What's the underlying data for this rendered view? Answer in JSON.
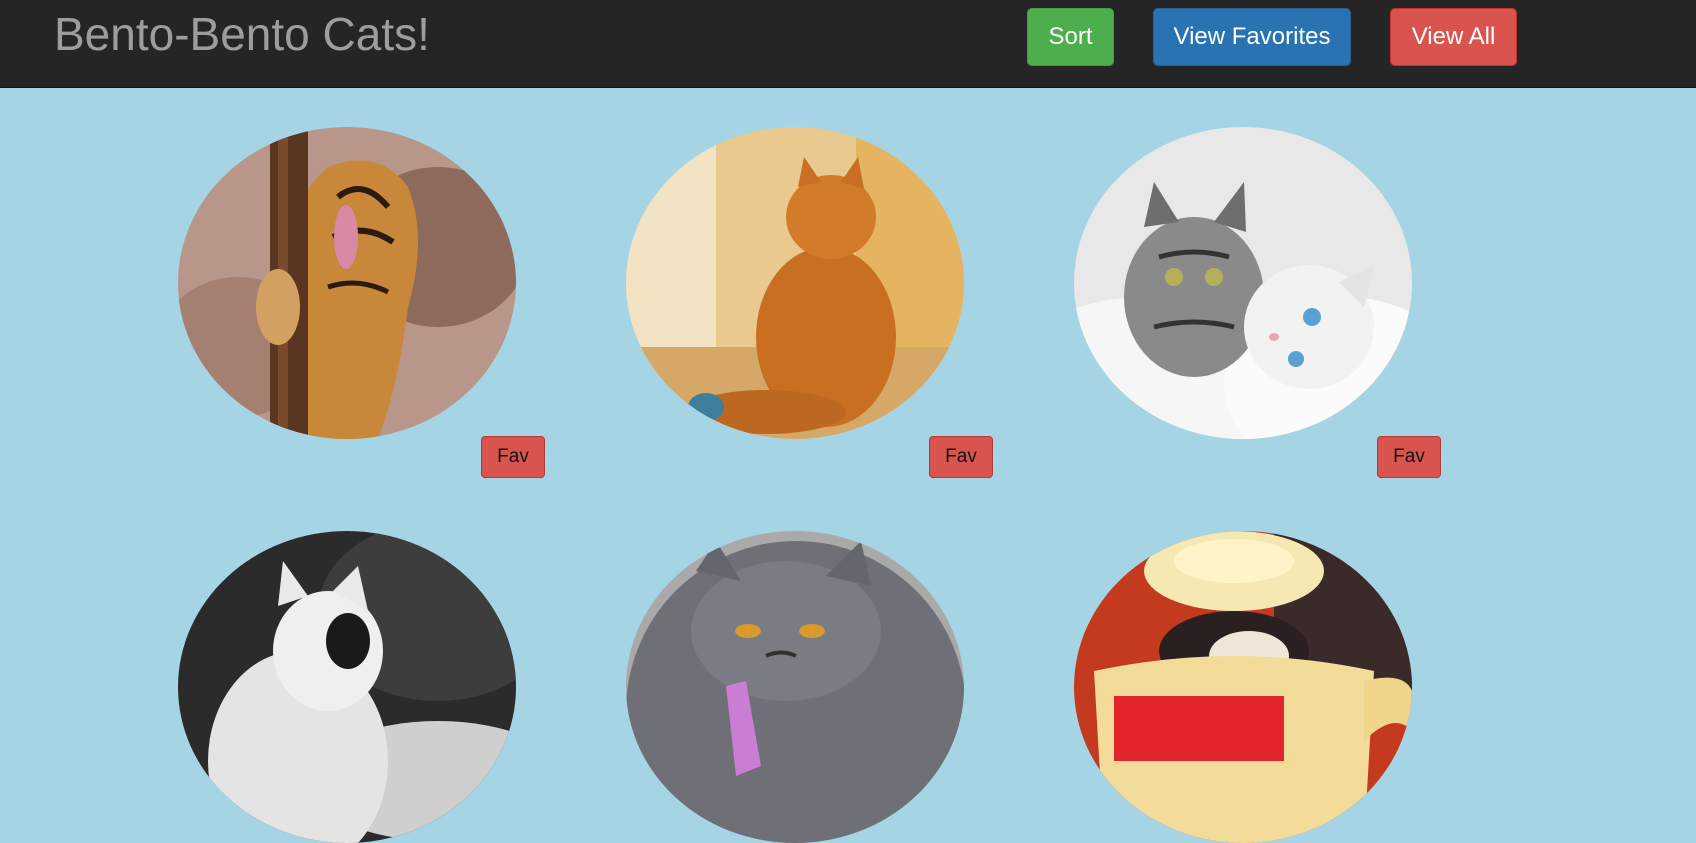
{
  "app": {
    "title": "Bento-Bento Cats!"
  },
  "toolbar": {
    "sort_label": "Sort",
    "favorites_label": "View Favorites",
    "all_label": "View All"
  },
  "cats": [
    {
      "image": "tiger-yawning-on-tree",
      "fav_label": "Fav"
    },
    {
      "image": "orange-cat-sitting-against-wall",
      "fav_label": "Fav"
    },
    {
      "image": "silver-and-white-kittens-cuddling",
      "fav_label": "Fav"
    },
    {
      "image": "black-and-white-cat-profile",
      "fav_label": ""
    },
    {
      "image": "grumpy-grey-persian-with-tie",
      "fav_label": ""
    },
    {
      "image": "kitten-in-teapot",
      "fav_label": ""
    }
  ],
  "colors": {
    "background": "#a5d5e5",
    "navbar": "#252525",
    "sort": "#4cae4c",
    "favorites": "#2a73b2",
    "all": "#d9534f",
    "fav": "#d9534f"
  }
}
